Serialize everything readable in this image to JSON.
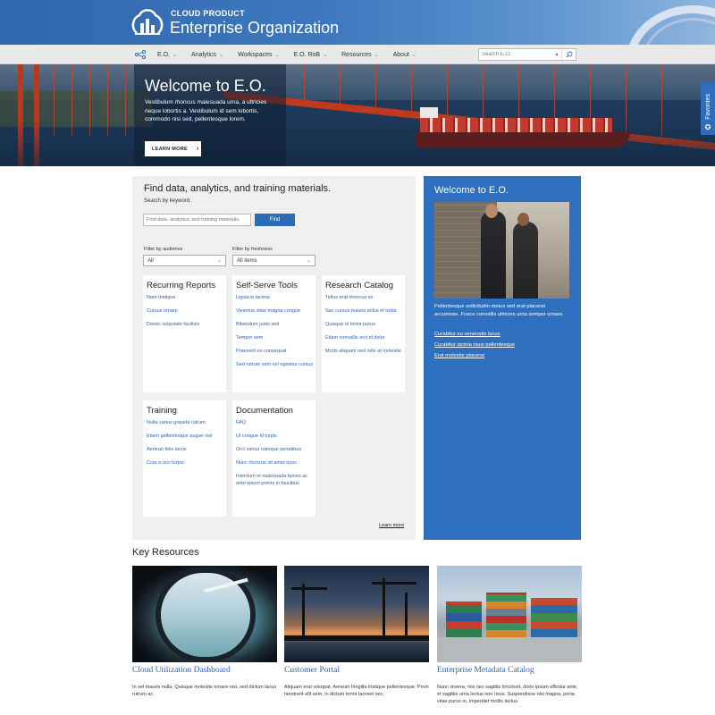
{
  "header": {
    "product_label": "CLOUD PRODUCT",
    "org_title": "Enterprise Organization",
    "brand_colors": {
      "banner": "#2f66ad",
      "accent": "#2a6cba",
      "side_panel": "#2e6fbf"
    }
  },
  "nav": {
    "items": [
      {
        "label": "E.O."
      },
      {
        "label": "Analytics"
      },
      {
        "label": "Workspaces"
      },
      {
        "label": "E.O. RoB"
      },
      {
        "label": "Resources"
      },
      {
        "label": "About"
      }
    ],
    "search_placeholder": "Search E.O.",
    "icons": {
      "nav": "network-icon",
      "search": "search-icon",
      "dropdown": "chevron-down-icon"
    }
  },
  "hero": {
    "title": "Welcome to E.O.",
    "text": "Vestibulum rhoncus malesuada urna, a ultricies neque lobortis a. Vestibulum id sem lobortis, commodo nisi sed, pellentesque lorem.",
    "button_label": "LEARN MORE",
    "button_arrow": "›"
  },
  "favorites": {
    "label": "Favorites",
    "icon": "star-icon"
  },
  "finder": {
    "title": "Find data, analytics, and training materials.",
    "subtitle": "Search by keyword.",
    "input_placeholder": "Find data, analytics, and training materials.",
    "button_label": "Find",
    "filters": [
      {
        "label": "Filter by audience",
        "value": "All"
      },
      {
        "label": "Filter by freshness",
        "value": "All items"
      }
    ],
    "cards": [
      {
        "title": "Recurring Reports",
        "links": [
          "Nam tristique",
          "Cursus ornare",
          "Donec vulputate facilisis"
        ]
      },
      {
        "title": "Self-Serve Tools",
        "links": [
          "Ligula in lacinia",
          "Vivamus vitae magna congue",
          "Bibendum justo sed",
          "Tempor sem",
          "Praesent eu consequat",
          "Sed rutrum sem vel egestas cursus"
        ]
      },
      {
        "title": "Research Catalog",
        "links": [
          "Tellus erat rhoncus ex",
          "Sac cursus mauris tellus et tortor",
          "Quisque id tortor purus",
          "Etiam convallis orci id dolor",
          "Morbi aliquam sed odio at molestie"
        ]
      },
      {
        "title": "Training",
        "links": [
          "Nulla varius gravida rutrum",
          "Etiam pellentesque augue nisl",
          "Aenean felis lacus",
          "Cras a orci turpis"
        ]
      },
      {
        "title": "Documentation",
        "links": [
          "FAQ",
          "Ut congue id turpis",
          "Orci varius natoque penatibus",
          "Nunc rhoncus sit amet nunc",
          "Interdum et malesuada fames ac ante ipsum primis in faucibus"
        ]
      }
    ],
    "learn_more": "Learn more"
  },
  "side": {
    "title": "Welcome to E.O.",
    "text": "Pellentesque sollicitudin metus sed erat placerat accumsan. Fusce convallis ultricies urna semper ornare.",
    "links": [
      "Curabitur eu venenatis lacus",
      "Curabitur lacinia risus pellentesque",
      "Erat molestie placerat"
    ]
  },
  "key_resources": {
    "title": "Key Resources",
    "items": [
      {
        "title": "Cloud Utilization Dashboard",
        "text": "In vel mauris nulla. Quisque molestie ornare nisi, sed dictum lacus rutrum ac."
      },
      {
        "title": "Customer Portal",
        "text": "Aliquam erat volutpat. Aenean fringilla tristique pellentesque. Proin hendrerit elit sem, in dictum tortor laoreet nec."
      },
      {
        "title": "Enterprise Metadata Catalog",
        "text": "Nunc viverra, nisi nec sagittis tincidunt, dolor ipsum efficitur ante, et sagittis urna lectus non risus. Suspendisse nisi magna, porta vitae purus in, imperdiet mollis lectus."
      }
    ]
  }
}
